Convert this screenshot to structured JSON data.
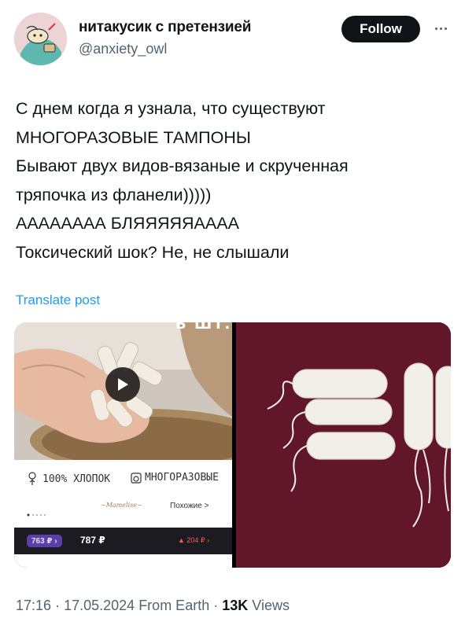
{
  "author": {
    "display_name": "нитакусик с претензией",
    "handle": "@anxiety_owl",
    "follow_label": "Follow"
  },
  "tweet": {
    "lines": [
      "С днем когда я узнала, что существуют",
      "МНОГОРАЗОВЫЕ ТАМПОНЫ",
      "Бывают двух видов-вязаные и скрученная",
      "тряпочка из фланели)))))",
      "АААААААА БЛЯЯЯЯЯАААА",
      "Токсический шок? Не, не слышали"
    ],
    "translate_label": "Translate post"
  },
  "media": {
    "left_ad": {
      "top_overlay_text": "Ь ШТ.",
      "cotton_label": "100% ХЛОПОК",
      "reusable_label": "МНОГОРАЗОВЫЕ",
      "brand_mark": "Mamelise",
      "similar_label": "Похожие >",
      "card_price": "763 ₽ ›",
      "price": "787 ₽",
      "discount_price": "▲ 204 ₽ ›"
    }
  },
  "footer": {
    "time": "17:16",
    "date": "17.05.2024",
    "source": "From Earth",
    "views_count": "13K",
    "views_label": "Views",
    "separator": "·"
  },
  "colors": {
    "accent_blue": "#1d9bf0",
    "text_primary": "#0f1419",
    "text_secondary": "#536471",
    "follow_bg": "#0f1419",
    "fabric_bg": "#5e1428"
  }
}
